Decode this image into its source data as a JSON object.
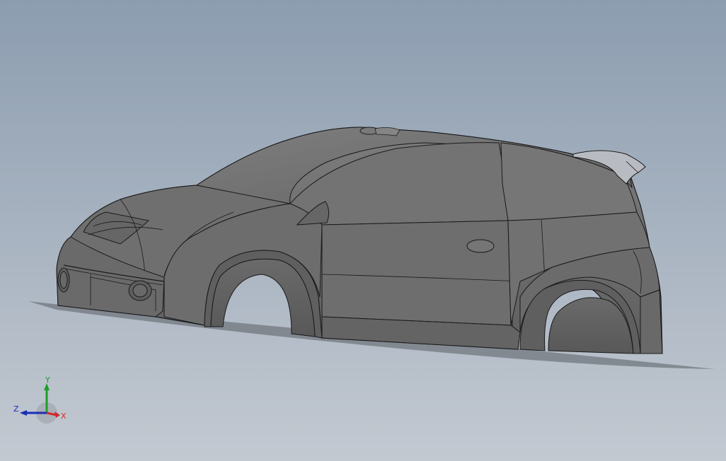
{
  "viewport": {
    "background_top": "#8c9db0",
    "background_bottom": "#c3c9d1"
  },
  "model": {
    "name": "car-body",
    "body_color": "#717171",
    "edge_color": "#1a1a1a",
    "shadow_color": "#5a5e64"
  },
  "triad": {
    "x_label": "X",
    "y_label": "Y",
    "z_label": "Z",
    "x_color": "#d42a2a",
    "y_color": "#1f9d2a",
    "z_color": "#1a2fb5"
  }
}
